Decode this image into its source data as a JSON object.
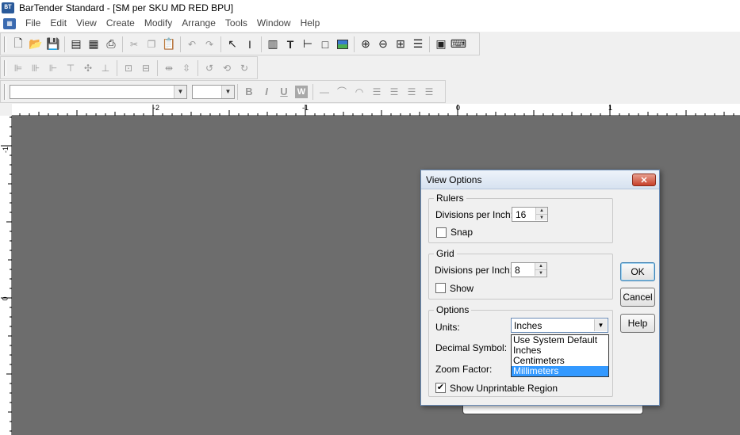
{
  "window": {
    "title": "BarTender Standard - [SM per SKU MD RED BPU]",
    "logo_text": "BT"
  },
  "menu": {
    "items": [
      "File",
      "Edit",
      "View",
      "Create",
      "Modify",
      "Arrange",
      "Tools",
      "Window",
      "Help"
    ]
  },
  "toolbar1": {
    "icons": [
      "new-file-icon",
      "open-folder-icon",
      "save-icon",
      "page-setup-icon",
      "database-icon",
      "print-icon",
      "cut-icon",
      "copy-icon",
      "paste-icon",
      "undo-icon",
      "redo-icon",
      "pointer-icon",
      "text-cursor-icon",
      "barcode-icon",
      "text-tool-icon",
      "line-tool-icon",
      "rectangle-tool-icon",
      "picture-tool-icon",
      "zoom-in-icon",
      "zoom-out-icon",
      "zoom-fit-icon",
      "zoom-page-icon",
      "toolbox-icon",
      "keyboard-icon"
    ]
  },
  "toolbar3": {
    "font_name": "",
    "font_size": "",
    "bold": "B",
    "italic": "I",
    "underline": "U",
    "word": "W"
  },
  "ruler": {
    "h_labels": [
      "-2",
      "-1",
      "0",
      "1"
    ],
    "v_labels": [
      "-1",
      "0"
    ]
  },
  "dialog": {
    "title": "View Options",
    "close_glyph": "✕",
    "rulers": {
      "legend": "Rulers",
      "divisions_label": "Divisions per Inch:",
      "divisions_value": "16",
      "snap_label": "Snap",
      "snap_checked": false
    },
    "grid": {
      "legend": "Grid",
      "divisions_label": "Divisions per Inch:",
      "divisions_value": "8",
      "show_label": "Show",
      "show_checked": false
    },
    "options": {
      "legend": "Options",
      "units_label": "Units:",
      "units_value": "Inches",
      "units_options": [
        "Use System Default",
        "Inches",
        "Centimeters",
        "Millimeters"
      ],
      "units_highlighted": "Millimeters",
      "decimal_label": "Decimal Symbol:",
      "zoom_label": "Zoom Factor:",
      "unprintable_label": "Show Unprintable Region",
      "unprintable_checked": true
    },
    "buttons": {
      "ok": "OK",
      "cancel": "Cancel",
      "help": "Help"
    }
  }
}
